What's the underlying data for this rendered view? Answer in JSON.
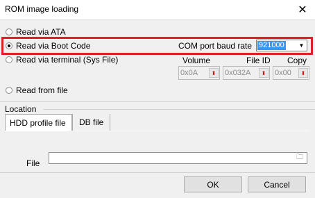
{
  "window": {
    "title": "ROM image loading",
    "close_glyph": "✕"
  },
  "options": {
    "ata": "Read via ATA",
    "boot_code": "Read via Boot Code",
    "terminal": "Read via terminal (Sys File)",
    "from_file": "Read from file",
    "selected": "boot_code"
  },
  "baud": {
    "label": "COM port baud rate",
    "value": "921000"
  },
  "terminal_fields": {
    "volume": {
      "label": "Volume",
      "value": "0x0A"
    },
    "file_id": {
      "label": "File ID",
      "value": "0x032A"
    },
    "copy": {
      "label": "Copy",
      "value": "0x00"
    }
  },
  "location": {
    "group_label": "Location",
    "tabs": [
      "HDD profile file",
      "DB file"
    ],
    "active_tab": "HDD profile file",
    "file_label": "File",
    "file_value": ""
  },
  "buttons": {
    "ok": "OK",
    "cancel": "Cancel"
  },
  "colors": {
    "highlight": "#e01f2b",
    "selection": "#3399ff"
  }
}
